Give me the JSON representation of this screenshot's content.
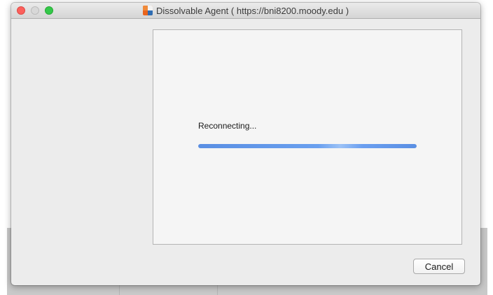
{
  "window": {
    "title": "Dissolvable Agent  ( https://bni8200.moody.edu )",
    "app_icon": "app-logo-icon"
  },
  "traffic_lights": {
    "close_color": "#fc605c",
    "minimize_color": "#d8d8d8",
    "zoom_color": "#34c84a"
  },
  "status": {
    "text": "Reconnecting...",
    "progress": 1.0,
    "progress_color": "#5a8fe3"
  },
  "buttons": {
    "cancel_label": "Cancel"
  }
}
